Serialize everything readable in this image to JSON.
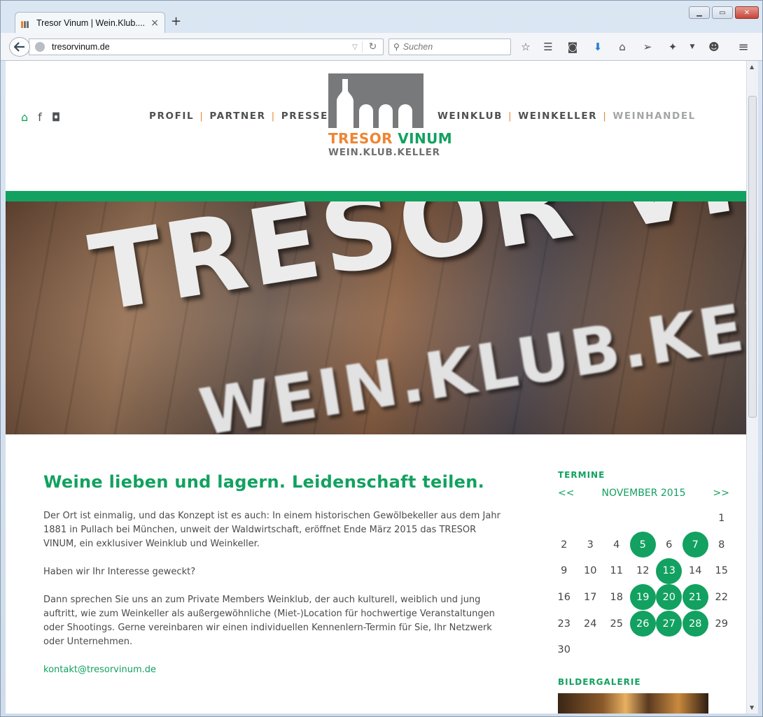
{
  "browser": {
    "tab_title": "Tresor Vinum | Wein.Klub....",
    "tab_close": "×",
    "new_tab": "+",
    "url": "tresorvinum.de",
    "search_placeholder": "Suchen"
  },
  "social": {
    "home": "⌂",
    "facebook": "f",
    "instagram": "◘"
  },
  "nav": {
    "left": [
      "PROFIL",
      "PARTNER",
      "PRESSE"
    ],
    "right": [
      "WEINKLUB",
      "WEINKELLER",
      "WEINHANDEL"
    ],
    "separator": "|"
  },
  "logo": {
    "word1": "TRESOR",
    "word2": "VINUM",
    "tagline": "WEIN.KLUB.KELLER"
  },
  "hero": {
    "line1": "TRESOR VINUM",
    "line2": "WEIN.KLUB.KELLER"
  },
  "main": {
    "headline": "Weine lieben und lagern. Leidenschaft teilen.",
    "paragraphs": [
      "Der Ort ist einmalig, und das Konzept ist es auch: In einem historischen Gewölbekeller aus dem Jahr 1881 in Pullach bei München, unweit der Waldwirtschaft, eröffnet Ende März 2015 das TRESOR VINUM, ein exklusiver Weinklub und Weinkeller.",
      "Haben wir Ihr Interesse geweckt?",
      "Dann sprechen Sie uns an zum Private Members Weinklub, der auch kulturell, weiblich und jung auftritt, wie zum Weinkeller als außergewöhnliche (Miet-)Location für hochwertige Veranstaltungen oder Shootings. Gerne vereinbaren wir einen individuellen Kennenlern-Termin für Sie, Ihr Netzwerk oder Unternehmen."
    ],
    "email": "kontakt@tresorvinum.de"
  },
  "sidebar": {
    "termine_heading": "TERMINE",
    "calendar": {
      "prev": "<<",
      "next": ">>",
      "month": "NOVEMBER 2015",
      "leading_blanks": 6,
      "days": 30,
      "event_days": [
        5,
        7,
        13,
        19,
        20,
        21,
        26,
        27,
        28
      ]
    },
    "gallery_heading": "BILDERGALERIE"
  },
  "colors": {
    "brand_green": "#12a160",
    "brand_orange": "#ee8533",
    "logo_grey": "#78797b"
  }
}
